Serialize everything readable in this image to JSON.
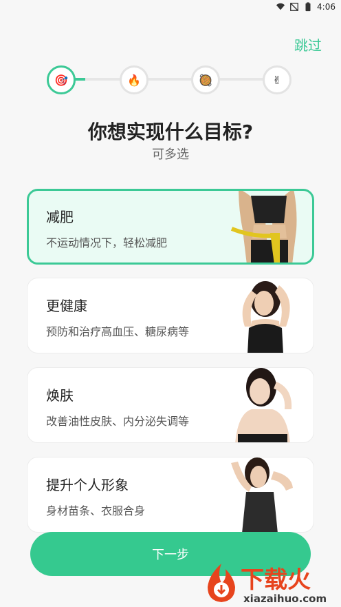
{
  "status_bar": {
    "time": "4:06"
  },
  "header": {
    "skip_label": "跳过"
  },
  "stepper": {
    "steps": [
      {
        "icon": "target-icon",
        "emoji": "🎯"
      },
      {
        "icon": "flame-icon",
        "emoji": "🔥"
      },
      {
        "icon": "pizza-icon",
        "emoji": "🥘"
      },
      {
        "icon": "victory-hand-icon",
        "emoji": "✌"
      }
    ],
    "current_step": 1,
    "accent_color": "#3cc996"
  },
  "question": {
    "title": "你想实现什么目标?",
    "subtitle": "可多选"
  },
  "goals": [
    {
      "title": "减肥",
      "desc": "不运动情况下，轻松减肥",
      "selected": true
    },
    {
      "title": "更健康",
      "desc": "预防和治疗高血压、糖尿病等",
      "selected": false
    },
    {
      "title": "焕肤",
      "desc": "改善油性皮肤、内分泌失调等",
      "selected": false
    },
    {
      "title": "提升个人形象",
      "desc": "身材苗条、衣服合身",
      "selected": false
    }
  ],
  "footer": {
    "next_label": "下一步"
  },
  "watermark": {
    "cn": "下载火",
    "en": "xiazaihuo.com"
  }
}
